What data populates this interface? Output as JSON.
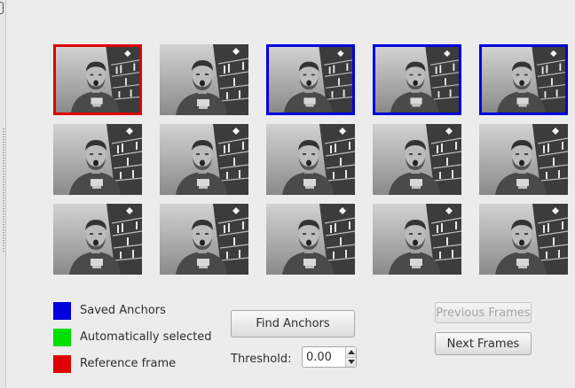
{
  "colors": {
    "saved": "#0000dd",
    "auto": "#00e000",
    "reference": "#e00000"
  },
  "frames": [
    {
      "state": "reference"
    },
    {
      "state": "none"
    },
    {
      "state": "saved"
    },
    {
      "state": "saved"
    },
    {
      "state": "saved"
    },
    {
      "state": "none"
    },
    {
      "state": "none"
    },
    {
      "state": "none"
    },
    {
      "state": "none"
    },
    {
      "state": "none"
    },
    {
      "state": "none"
    },
    {
      "state": "none"
    },
    {
      "state": "none"
    },
    {
      "state": "none"
    },
    {
      "state": "none"
    }
  ],
  "legend": {
    "saved_label": "Saved Anchors",
    "auto_label": "Automatically selected",
    "reference_label": "Reference frame"
  },
  "controls": {
    "find_anchors_label": "Find Anchors",
    "threshold_label": "Threshold:",
    "threshold_value": "0.00",
    "previous_frames_label": "Previous Frames",
    "next_frames_label": "Next Frames"
  }
}
